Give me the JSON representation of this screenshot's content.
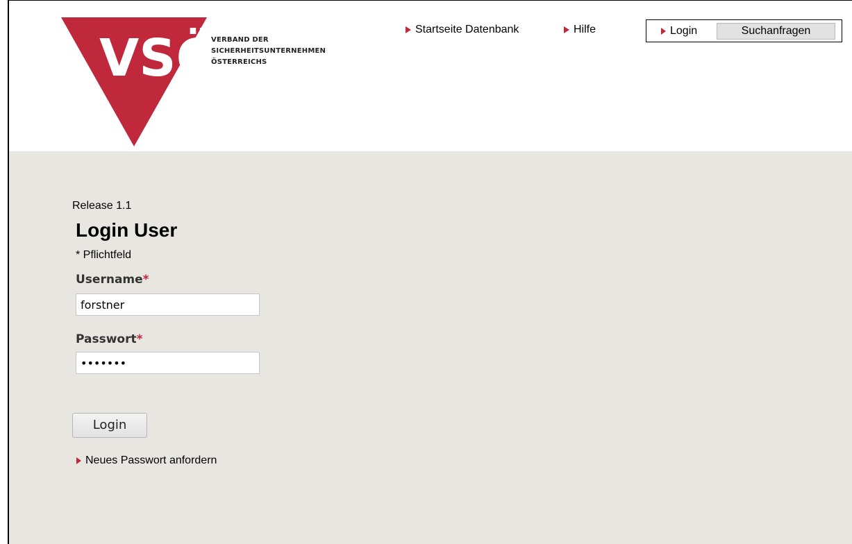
{
  "header": {
    "logo_text": "VSÖ",
    "org_name_lines": [
      "VERBAND DER",
      "SICHERHEITSUNTERNEHMEN",
      "ÖSTERREICHS"
    ],
    "nav": {
      "startseite_label": "Startseite Datenbank",
      "hilfe_label": "Hilfe"
    },
    "tabs": {
      "login_label": "Login",
      "suchanfragen_label": "Suchanfragen"
    }
  },
  "main": {
    "release": "Release 1.1",
    "title": "Login User",
    "required_note": "* Pflichtfeld",
    "username": {
      "label": "Username",
      "required_mark": "*",
      "value": "forstner"
    },
    "password": {
      "label": "Passwort",
      "required_mark": "*",
      "value": "•••••••"
    },
    "login_button_label": "Login",
    "forgot_password_label": "Neues Passwort anfordern"
  },
  "colors": {
    "brand_red": "#c0283c",
    "content_background": "#e7e6e1"
  },
  "icons": {
    "nav_bullet": "triangle-right-icon"
  }
}
